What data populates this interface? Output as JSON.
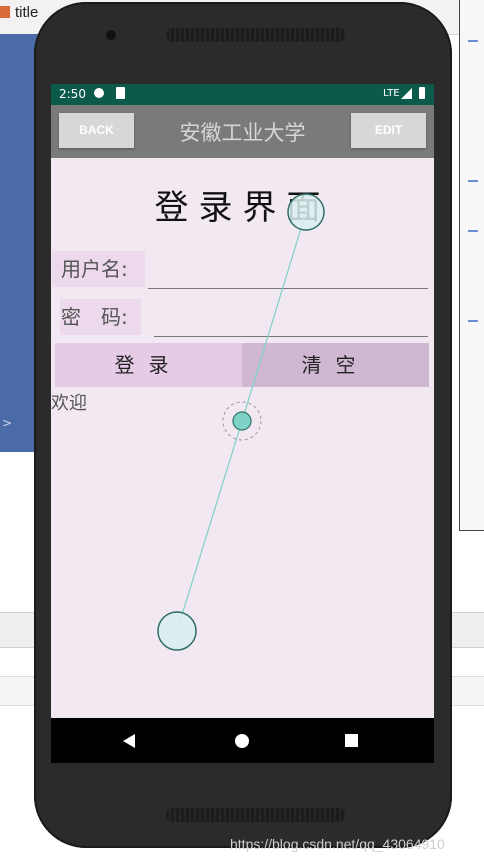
{
  "ide": {
    "tab_title": "title",
    "watermark": "https://blog.csdn.net/qq_43064910"
  },
  "status_bar": {
    "time": "2:50",
    "network": "LTE"
  },
  "app_bar": {
    "back_label": "BACK",
    "title": "安徽工业大学",
    "edit_label": "EDIT"
  },
  "login_form": {
    "heading": "登录界面",
    "username_label": "用户名:",
    "username_value": "",
    "password_label": "密　码:",
    "password_value": "",
    "login_button": "登录",
    "clear_button": "清空",
    "welcome_text": "欢迎"
  },
  "colors": {
    "status_bar": "#0c5a4a",
    "app_bar": "#7a7a7a",
    "screen_bg": "#f1e8f1",
    "login_button_bg": "#e6cbe6",
    "clear_button_bg": "#d0b8d3",
    "gesture_accent": "#7ed3c6"
  },
  "icons": {
    "nav_back": "triangle-back-icon",
    "nav_home": "circle-home-icon",
    "nav_recents": "square-recents-icon",
    "status_signal": "signal-icon",
    "status_battery": "battery-icon"
  }
}
